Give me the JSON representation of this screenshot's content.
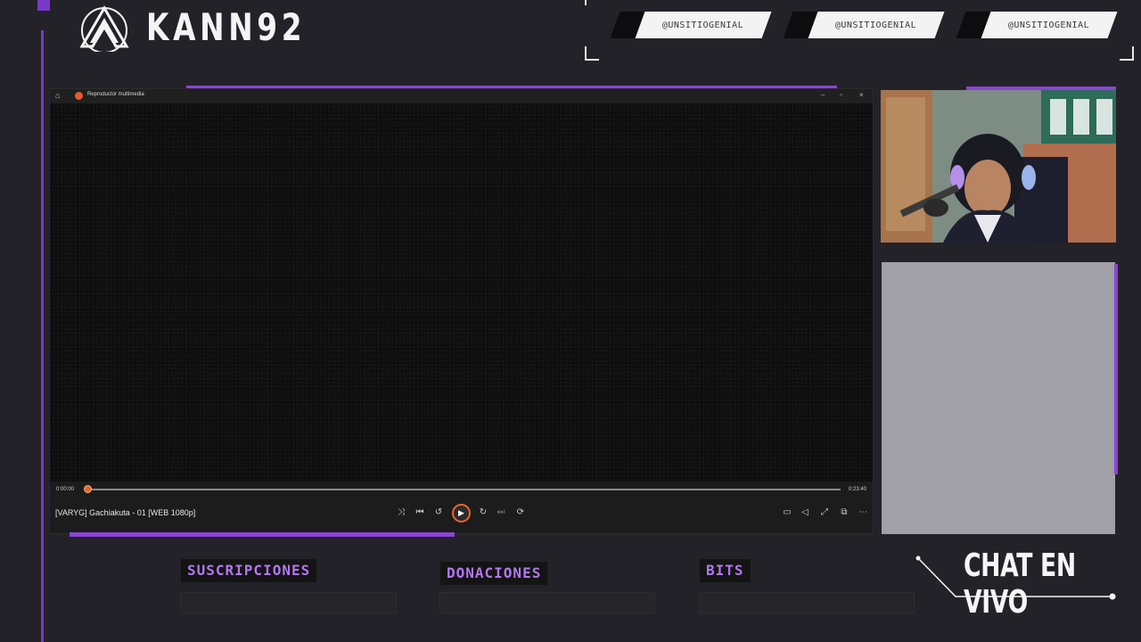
{
  "brand": {
    "name": "KANN92",
    "logo_icon": "stylized-a-logo-icon"
  },
  "social": {
    "tags": [
      "@UNSITIOGENIAL",
      "@UNSITIOGENIAL",
      "@UNSITIOGENIAL"
    ]
  },
  "player": {
    "window_title": "Reproductor multimedia",
    "track_title": "[VARYG] Gachiakuta - 01 [WEB 1080p]",
    "current_time": "0:00:00",
    "total_time": "0:23:40",
    "progress_fraction": 0.0,
    "controls": [
      "shuffle-icon",
      "previous-icon",
      "replay-10-icon",
      "play-icon",
      "forward-30-icon",
      "next-icon",
      "repeat-off-icon"
    ],
    "right_controls": [
      "subtitles-icon",
      "volume-icon",
      "fullscreen-icon",
      "miniplayer-icon",
      "more-icon"
    ]
  },
  "stream": {
    "chat_label": "CHAT EN VIVO"
  },
  "stats": {
    "subs_label": "SUSCRIPCIONES",
    "donations_label": "DONACIONES",
    "bits_label": "BITS"
  },
  "colors": {
    "accent": "#8a44d6",
    "background": "#232228",
    "play_ring": "#e8672e"
  }
}
